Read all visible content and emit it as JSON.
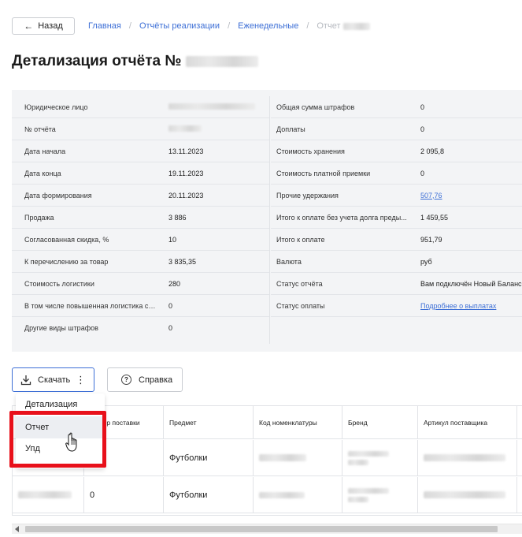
{
  "header": {
    "back_label": "Назад",
    "breadcrumbs": [
      "Главная",
      "Отчёты реализации",
      "Еженедельные"
    ],
    "current_crumb": "Отчет"
  },
  "page_title": "Детализация отчёта №",
  "details": {
    "left": [
      {
        "label": "Юридическое лицо",
        "value": ""
      },
      {
        "label": "№ отчёта",
        "value": ""
      },
      {
        "label": "Дата начала",
        "value": "13.11.2023"
      },
      {
        "label": "Дата конца",
        "value": "19.11.2023"
      },
      {
        "label": "Дата формирования",
        "value": "20.11.2023"
      },
      {
        "label": "Продажа",
        "value": "3 886"
      },
      {
        "label": "Согласованная скидка, %",
        "value": "10"
      },
      {
        "label": "К перечислению за товар",
        "value": "3 835,35"
      },
      {
        "label": "Стоимость логистики",
        "value": "280"
      },
      {
        "label": "В том числе повышенная логистика со...",
        "value": "0"
      },
      {
        "label": "Другие виды штрафов",
        "value": "0"
      }
    ],
    "right": [
      {
        "label": "Общая сумма штрафов",
        "value": "0"
      },
      {
        "label": "Доплаты",
        "value": "0"
      },
      {
        "label": "Стоимость хранения",
        "value": "2 095,8"
      },
      {
        "label": "Стоимость платной приемки",
        "value": "0"
      },
      {
        "label": "Прочие удержания",
        "value": "507,76"
      },
      {
        "label": "Итого к оплате без учета долга преды...",
        "value": "1 459,55"
      },
      {
        "label": "Итого к оплате",
        "value": "951,79"
      },
      {
        "label": "Валюта",
        "value": "руб"
      },
      {
        "label": "Статус отчёта",
        "value": "Вам подключён Новый Баланс"
      },
      {
        "label": "Статус оплаты",
        "value": "Подробнее о выплатах"
      }
    ]
  },
  "actions": {
    "download_label": "Скачать",
    "help_label": "Справка"
  },
  "download_menu": {
    "items": [
      "Детализация",
      "Отчет",
      "Упд"
    ]
  },
  "table": {
    "headers": [
      "",
      "Номер поставки",
      "Предмет",
      "Код номенклатуры",
      "Бренд",
      "Артикул поставщика"
    ],
    "rows": [
      {
        "supply": "",
        "subject": "Футболки"
      },
      {
        "supply": "0",
        "subject": "Футболки"
      }
    ]
  }
}
